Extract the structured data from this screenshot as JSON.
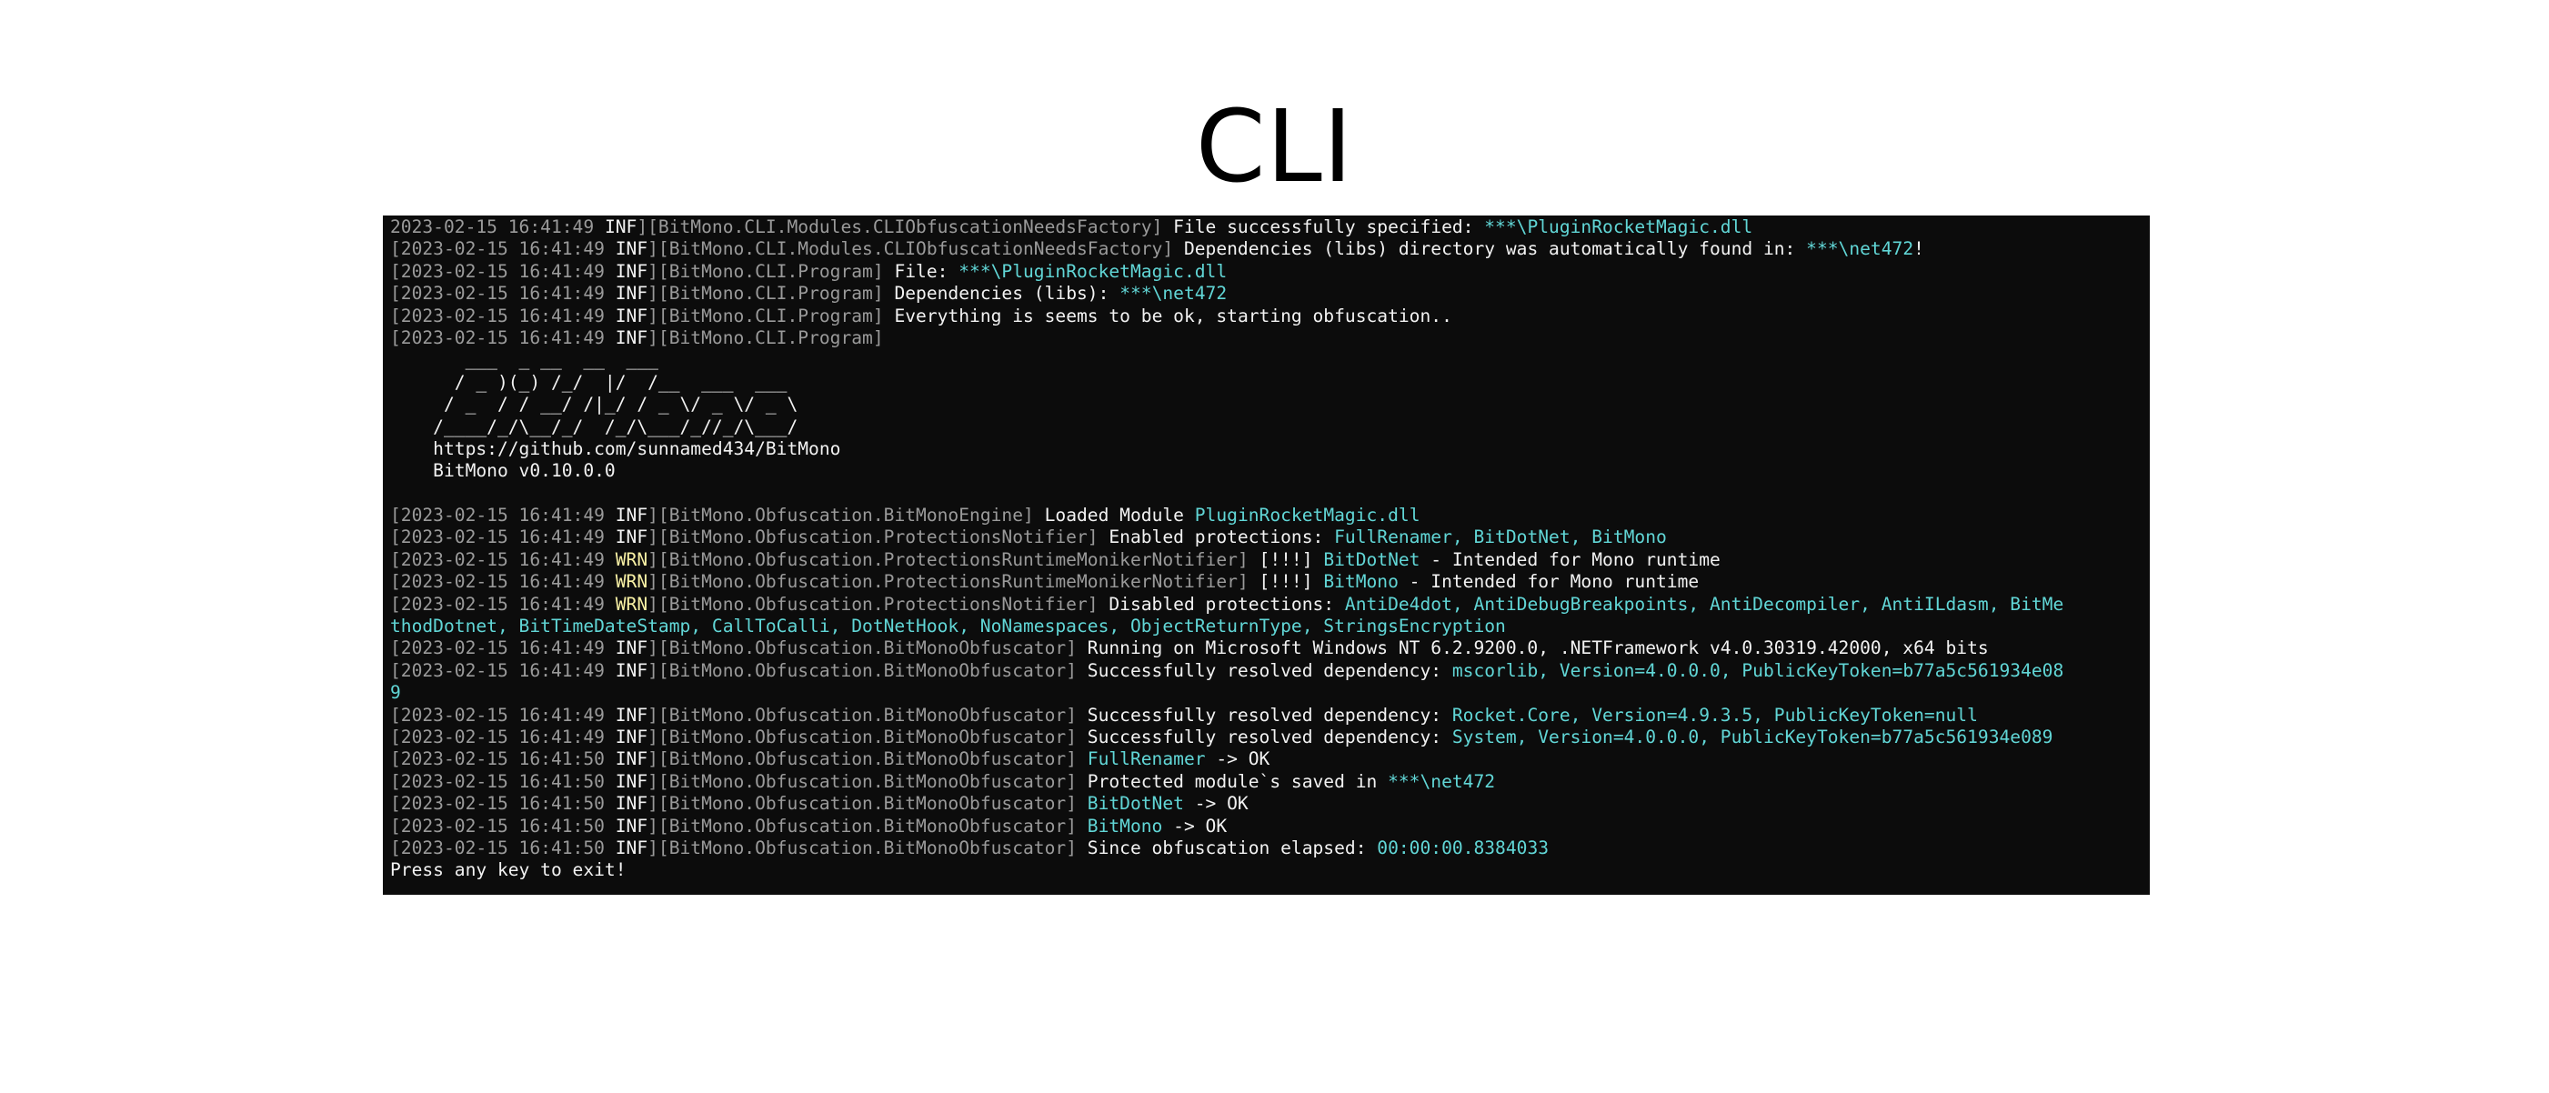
{
  "page": {
    "title": "CLI"
  },
  "colors": {
    "terminal_bg": "#0c0c0c",
    "bracket_gray": "#9a9a9a",
    "text_white": "#f2f2f2",
    "highlight_cyan": "#61d6d6",
    "warn_yellow": "#f9f1a5"
  },
  "log": {
    "l1": {
      "ts": "2023-02-15 16:41:49 ",
      "lvl": "INF",
      "src": "BitMono.CLI.Modules.CLIObfuscationNeedsFactory",
      "msg": " File successfully specified: ",
      "hl": "***\\PluginRocketMagic.dll"
    },
    "l2": {
      "ts": "2023-02-15 16:41:49 ",
      "lvl": "INF",
      "src": "BitMono.CLI.Modules.CLIObfuscationNeedsFactory",
      "msg": " Dependencies (libs) directory was automatically found in: ",
      "hl": "***\\net472",
      "tail": "!"
    },
    "l3": {
      "ts": "2023-02-15 16:41:49 ",
      "lvl": "INF",
      "src": "BitMono.CLI.Program",
      "msg": " File: ",
      "hl": "***\\PluginRocketMagic.dll"
    },
    "l4": {
      "ts": "2023-02-15 16:41:49 ",
      "lvl": "INF",
      "src": "BitMono.CLI.Program",
      "msg": " Dependencies (libs): ",
      "hl": "***\\net472"
    },
    "l5": {
      "ts": "2023-02-15 16:41:49 ",
      "lvl": "INF",
      "src": "BitMono.CLI.Program",
      "msg": " Everything is seems to be ok, starting obfuscation.."
    },
    "l6": {
      "ts": "2023-02-15 16:41:49 ",
      "lvl": "INF",
      "src": "BitMono.CLI.Program"
    },
    "banner": {
      "art1": "       ___  _ __  __  ___",
      "art2": "      / _ )(_) /_/  |/  /__  ___  ___",
      "art3": "     / _  / / __/ /|_/ / _ \\/ _ \\/ _ \\",
      "art4": "    /____/_/\\__/_/  /_/\\___/_//_/\\___/",
      "url": "    https://github.com/sunnamed434/BitMono",
      "version": "    BitMono v0.10.0.0"
    },
    "l7": {
      "ts": "2023-02-15 16:41:49 ",
      "lvl": "INF",
      "src": "BitMono.Obfuscation.BitMonoEngine",
      "msg": " Loaded Module ",
      "hl": "PluginRocketMagic.dll"
    },
    "l8": {
      "ts": "2023-02-15 16:41:49 ",
      "lvl": "INF",
      "src": "BitMono.Obfuscation.ProtectionsNotifier",
      "msg": " Enabled protections: ",
      "hl": "FullRenamer, BitDotNet, BitMono"
    },
    "l9": {
      "ts": "2023-02-15 16:41:49 ",
      "lvl": "WRN",
      "src": "BitMono.Obfuscation.ProtectionsRuntimeMonikerNotifier",
      "msg": " [!!!] ",
      "hl": "BitDotNet",
      "tail": " - Intended for Mono runtime"
    },
    "l10": {
      "ts": "2023-02-15 16:41:49 ",
      "lvl": "WRN",
      "src": "BitMono.Obfuscation.ProtectionsRuntimeMonikerNotifier",
      "msg": " [!!!] ",
      "hl": "BitMono",
      "tail": " - Intended for Mono runtime"
    },
    "l11": {
      "ts": "2023-02-15 16:41:49 ",
      "lvl": "WRN",
      "src": "BitMono.Obfuscation.ProtectionsNotifier",
      "msg": " Disabled protections: ",
      "hl": "AntiDe4dot, AntiDebugBreakpoints, AntiDecompiler, AntiILdasm, BitMe",
      "cont": "thodDotnet, BitTimeDateStamp, CallToCalli, DotNetHook, NoNamespaces, ObjectReturnType, StringsEncryption"
    },
    "l12": {
      "ts": "2023-02-15 16:41:49 ",
      "lvl": "INF",
      "src": "BitMono.Obfuscation.BitMonoObfuscator",
      "msg": " Running on Microsoft Windows NT 6.2.9200.0, .NETFramework v4.0.30319.42000, x64 bits"
    },
    "l13": {
      "ts": "2023-02-15 16:41:49 ",
      "lvl": "INF",
      "src": "BitMono.Obfuscation.BitMonoObfuscator",
      "msg": " Successfully resolved dependency: ",
      "hl": "mscorlib, Version=4.0.0.0, PublicKeyToken=b77a5c561934e08",
      "cont": "9"
    },
    "l14": {
      "ts": "2023-02-15 16:41:49 ",
      "lvl": "INF",
      "src": "BitMono.Obfuscation.BitMonoObfuscator",
      "msg": " Successfully resolved dependency: ",
      "hl": "Rocket.Core, Version=4.9.3.5, PublicKeyToken=null"
    },
    "l15": {
      "ts": "2023-02-15 16:41:49 ",
      "lvl": "INF",
      "src": "BitMono.Obfuscation.BitMonoObfuscator",
      "msg": " Successfully resolved dependency: ",
      "hl": "System, Version=4.0.0.0, PublicKeyToken=b77a5c561934e089"
    },
    "l16": {
      "ts": "2023-02-15 16:41:50 ",
      "lvl": "INF",
      "src": "BitMono.Obfuscation.BitMonoObfuscator",
      "msg": " ",
      "hl": "FullRenamer",
      "tail": " -> OK"
    },
    "l17": {
      "ts": "2023-02-15 16:41:50 ",
      "lvl": "INF",
      "src": "BitMono.Obfuscation.BitMonoObfuscator",
      "msg": " Protected module`s saved in ",
      "hl": "***\\net472"
    },
    "l18": {
      "ts": "2023-02-15 16:41:50 ",
      "lvl": "INF",
      "src": "BitMono.Obfuscation.BitMonoObfuscator",
      "msg": " ",
      "hl": "BitDotNet",
      "tail": " -> OK"
    },
    "l19": {
      "ts": "2023-02-15 16:41:50 ",
      "lvl": "INF",
      "src": "BitMono.Obfuscation.BitMonoObfuscator",
      "msg": " ",
      "hl": "BitMono",
      "tail": " -> OK"
    },
    "l20": {
      "ts": "2023-02-15 16:41:50 ",
      "lvl": "INF",
      "src": "BitMono.Obfuscation.BitMonoObfuscator",
      "msg": " Since obfuscation elapsed: ",
      "hl": "00:00:00.8384033"
    },
    "exit": "Press any key to exit!"
  }
}
